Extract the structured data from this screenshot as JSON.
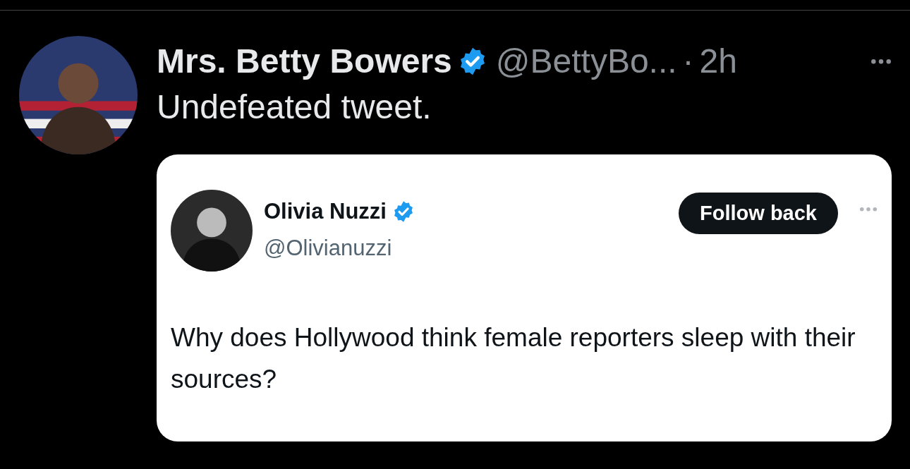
{
  "post": {
    "author": {
      "name": "Mrs. Betty Bowers",
      "verified": true,
      "handle": "@BettyBo...",
      "separator": "·",
      "time": "2h"
    },
    "text": "Undefeated tweet.",
    "quoted": {
      "author": {
        "name": "Olivia Nuzzi",
        "verified": true,
        "handle": "@Olivianuzzi"
      },
      "follow_button": "Follow back",
      "text": "Why does Hollywood think female reporters sleep with their sources?"
    }
  }
}
